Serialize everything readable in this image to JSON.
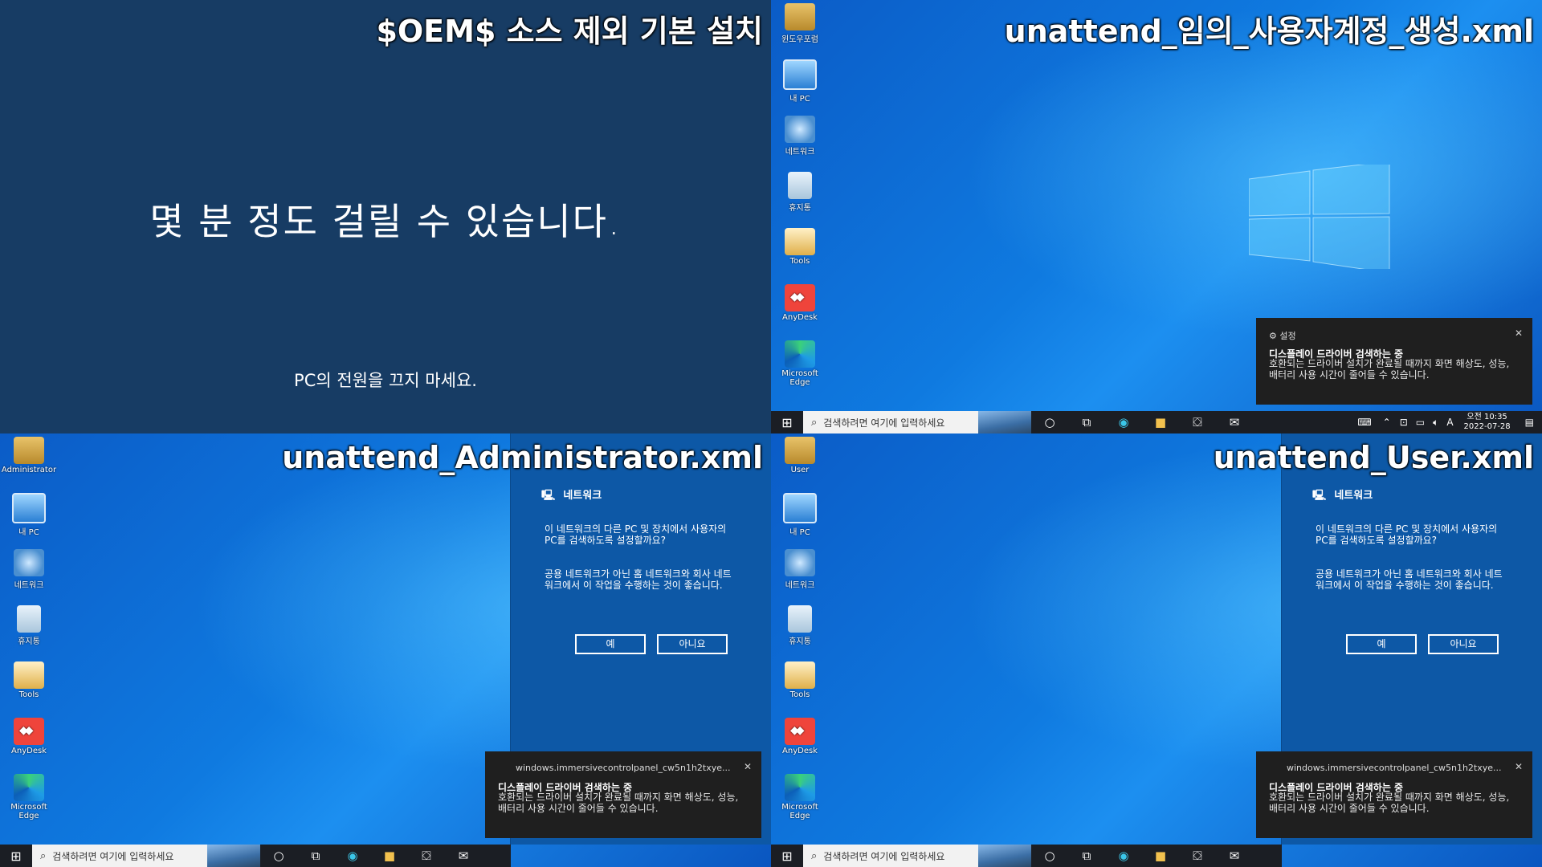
{
  "q1": {
    "overlay": "$OEM$ 소스 제외 기본 설치",
    "main_text": "몇 분 정도 걸릴 수 있습니다.",
    "sub_text": "PC의 전원을 끄지 마세요."
  },
  "q2": {
    "overlay": "unattend_임의_사용자계정_생성.xml",
    "icons": [
      "윈도우포럼",
      "내 PC",
      "네트워크",
      "휴지통",
      "Tools",
      "AnyDesk",
      "Microsoft Edge"
    ],
    "toast": {
      "app": "설정",
      "title": "디스플레이 드라이버 검색하는 중",
      "body": "호환되는 드라이버 설치가 완료될 때까지 화면 해상도, 성능, 배터리 사용 시간이 줄어들 수 있습니다."
    },
    "clock_time": "오전 10:35",
    "clock_date": "2022-07-28",
    "ime": "A"
  },
  "q3": {
    "overlay": "unattend_Administrator.xml",
    "icons": [
      "Administrator",
      "내 PC",
      "네트워크",
      "휴지통",
      "Tools",
      "AnyDesk",
      "Microsoft Edge"
    ]
  },
  "q4": {
    "overlay": "unattend_User.xml",
    "icons": [
      "User",
      "내 PC",
      "네트워크",
      "휴지통",
      "Tools",
      "AnyDesk",
      "Microsoft Edge"
    ]
  },
  "network_panel": {
    "title": "네트워크",
    "question": "이 네트워크의 다른 PC 및 장치에서 사용자의 PC를 검색하도록 설정할까요?",
    "advice": "공용 네트워크가 아닌 홈 네트워크와 회사 네트워크에서 이 작업을 수행하는 것이 좋습니다.",
    "yes": "예",
    "no": "아니요"
  },
  "toast2": {
    "app": "windows.immersivecontrolpanel_cw5n1h2txye...",
    "title": "디스플레이 드라이버 검색하는 중",
    "body": "호환되는 드라이버 설치가 완료될 때까지 화면 해상도, 성능, 배터리 사용 시간이 줄어들 수 있습니다."
  },
  "taskbar": {
    "search_placeholder": "검색하려면 여기에 입력하세요"
  },
  "colors": {
    "oobe_bg": "#173c64",
    "desktop_blue": "#0f7ae0",
    "panel_blue": "#0d58a6",
    "taskbar": "#1b1e24"
  }
}
